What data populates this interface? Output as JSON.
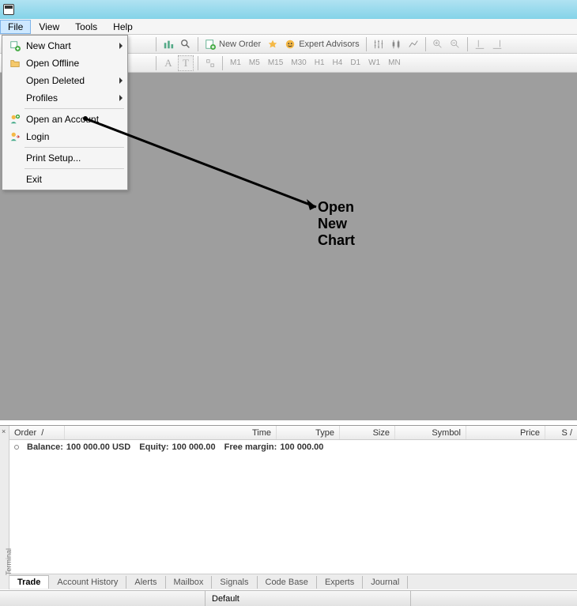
{
  "title": "",
  "menubar": [
    "File",
    "View",
    "Tools",
    "Help"
  ],
  "menubar_active_index": 0,
  "file_menu": {
    "new_chart": "New Chart",
    "open_offline": "Open Offline",
    "open_deleted": "Open Deleted",
    "profiles": "Profiles",
    "open_account": "Open an Account",
    "login": "Login",
    "print_setup": "Print Setup...",
    "exit": "Exit"
  },
  "toolbar": {
    "new_order": "New Order",
    "expert_advisors": "Expert Advisors"
  },
  "timeframes": [
    "M1",
    "M5",
    "M15",
    "M30",
    "H1",
    "H4",
    "D1",
    "W1",
    "MN"
  ],
  "annotation": "Open New Chart",
  "terminal": {
    "vbar_label": "Terminal",
    "columns": {
      "order": "Order",
      "time": "Time",
      "type": "Type",
      "size": "Size",
      "symbol": "Symbol",
      "price": "Price",
      "sl": "S /"
    },
    "balance_label": "Balance:",
    "balance_value": "100 000.00 USD",
    "equity_label": "Equity:",
    "equity_value": "100 000.00",
    "freemargin_label": "Free margin:",
    "freemargin_value": "100 000.00",
    "tabs": [
      "Trade",
      "Account History",
      "Alerts",
      "Mailbox",
      "Signals",
      "Code Base",
      "Experts",
      "Journal"
    ],
    "active_tab_index": 0
  },
  "statusbar": {
    "help": "",
    "profile": "Default"
  }
}
